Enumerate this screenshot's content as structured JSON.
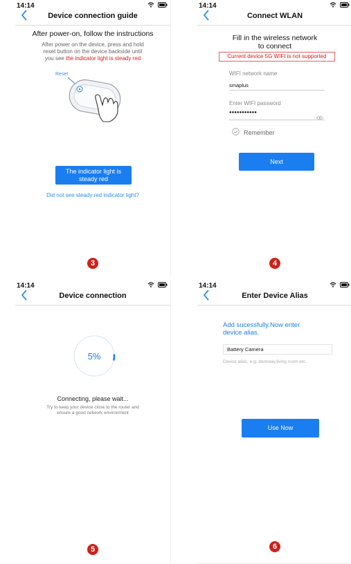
{
  "status_time": "14:14",
  "colors": {
    "accent": "#1a7ef0",
    "warning": "#e01515",
    "link": "#2f8ee8",
    "step_marker": "#d0201a"
  },
  "screen3": {
    "title": "Device connection guide",
    "heading": "After power-on, follow the instructions",
    "instruction_line1": "After power on the device, press and hold",
    "instruction_line2": "reset button on the device backside until",
    "instruction_line3_prefix": "you see ",
    "instruction_line3_highlight": "the indicator light is steady red",
    "reset_label": "Reset",
    "confirm_button_line1": "The indicator light is",
    "confirm_button_line2": "steady red",
    "help_link": "Did not see steady red indicator light?",
    "step": "3"
  },
  "screen4": {
    "title": "Connect WLAN",
    "heading_line1": "Fill in the wireless network",
    "heading_line2": "to connect",
    "warning": "Current device 5G WIFI is not supported",
    "wifi_name_label": "WIFI network name",
    "wifi_name_value": "smaplus",
    "password_label": "Enter WIFI password",
    "password_value": "●●●●●●●●●●●",
    "remember_label": "Remember",
    "next_button": "Next",
    "step": "4"
  },
  "screen5": {
    "title": "Device connection",
    "progress": "5%",
    "progress_fraction": 0.05,
    "status": "Connecting, please wait...",
    "tip_line1": "Try to keep your device close to the router and",
    "tip_line2": "ensure a good network environment",
    "step": "5"
  },
  "screen6": {
    "title": "Enter Device Alias",
    "heading_line1": "Add sucessfully.Now enter",
    "heading_line2": "device alias.",
    "alias_value": "Battery Camera",
    "alias_hint": "Device alias, e.g:  doorway,living room etc.",
    "use_button": "Use Now",
    "step": "6"
  }
}
